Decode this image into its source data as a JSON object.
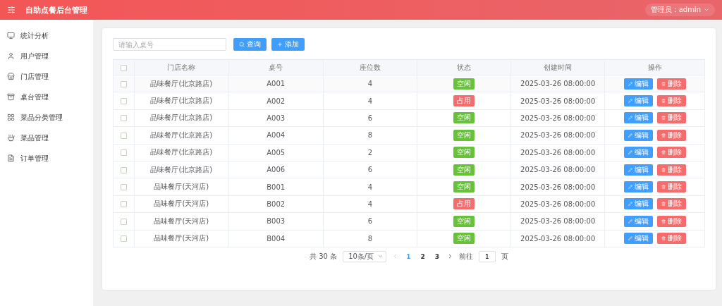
{
  "header": {
    "title": "自助点餐后台管理",
    "user": "管理员：admin"
  },
  "sidebar": {
    "items": [
      {
        "label": "统计分析",
        "selected": false
      },
      {
        "label": "用户管理",
        "selected": false
      },
      {
        "label": "门店管理",
        "selected": false
      },
      {
        "label": "桌台管理",
        "selected": false
      },
      {
        "label": "菜品分类管理",
        "selected": false
      },
      {
        "label": "菜品管理",
        "selected": false
      },
      {
        "label": "订单管理",
        "selected": false
      }
    ]
  },
  "toolbar": {
    "search": {
      "placeholder": "请输入桌号"
    },
    "buttons": [
      {
        "label": "查询",
        "kind": "search"
      },
      {
        "label": "添加",
        "kind": "add"
      }
    ]
  },
  "table": {
    "select_all": {
      "checked": false
    },
    "columns": [
      "门店名称",
      "桌号",
      "座位数",
      "状态",
      "创建时间",
      "操作"
    ],
    "rows": [
      {
        "checked": false,
        "store": "品味餐厅(北京路店)",
        "table_no": "A001",
        "seats": "4",
        "status": {
          "label": "空闲",
          "kind": "free"
        },
        "created": "2025-03-26 08:00:00",
        "actions": [
          "编辑",
          "删除"
        ]
      },
      {
        "checked": false,
        "store": "品味餐厅(北京路店)",
        "table_no": "A002",
        "seats": "4",
        "status": {
          "label": "占用",
          "kind": "occupied"
        },
        "created": "2025-03-26 08:00:00",
        "actions": [
          "编辑",
          "删除"
        ]
      },
      {
        "checked": false,
        "store": "品味餐厅(北京路店)",
        "table_no": "A003",
        "seats": "6",
        "status": {
          "label": "空闲",
          "kind": "free"
        },
        "created": "2025-03-26 08:00:00",
        "actions": [
          "编辑",
          "删除"
        ]
      },
      {
        "checked": false,
        "store": "品味餐厅(北京路店)",
        "table_no": "A004",
        "seats": "8",
        "status": {
          "label": "空闲",
          "kind": "free"
        },
        "created": "2025-03-26 08:00:00",
        "actions": [
          "编辑",
          "删除"
        ]
      },
      {
        "checked": false,
        "store": "品味餐厅(北京路店)",
        "table_no": "A005",
        "seats": "2",
        "status": {
          "label": "空闲",
          "kind": "free"
        },
        "created": "2025-03-26 08:00:00",
        "actions": [
          "编辑",
          "删除"
        ]
      },
      {
        "checked": false,
        "store": "品味餐厅(北京路店)",
        "table_no": "A006",
        "seats": "6",
        "status": {
          "label": "空闲",
          "kind": "free"
        },
        "created": "2025-03-26 08:00:00",
        "actions": [
          "编辑",
          "删除"
        ]
      },
      {
        "checked": false,
        "store": "品味餐厅(天河店)",
        "table_no": "B001",
        "seats": "4",
        "status": {
          "label": "空闲",
          "kind": "free"
        },
        "created": "2025-03-26 08:00:00",
        "actions": [
          "编辑",
          "删除"
        ]
      },
      {
        "checked": false,
        "store": "品味餐厅(天河店)",
        "table_no": "B002",
        "seats": "4",
        "status": {
          "label": "占用",
          "kind": "occupied"
        },
        "created": "2025-03-26 08:00:00",
        "actions": [
          "编辑",
          "删除"
        ]
      },
      {
        "checked": false,
        "store": "品味餐厅(天河店)",
        "table_no": "B003",
        "seats": "6",
        "status": {
          "label": "空闲",
          "kind": "free"
        },
        "created": "2025-03-26 08:00:00",
        "actions": [
          "编辑",
          "删除"
        ]
      },
      {
        "checked": false,
        "store": "品味餐厅(天河店)",
        "table_no": "B004",
        "seats": "8",
        "status": {
          "label": "空闲",
          "kind": "free"
        },
        "created": "2025-03-26 08:00:00",
        "actions": [
          "编辑",
          "删除"
        ]
      }
    ]
  },
  "pagination": {
    "total": "共 30 条",
    "page_size": "10条/页",
    "pages": [
      {
        "label": "1",
        "selected": true
      },
      {
        "label": "2",
        "selected": false
      },
      {
        "label": "3",
        "selected": false
      }
    ],
    "goto_label": "前往",
    "goto_value": "1",
    "goto_suffix": "页"
  }
}
